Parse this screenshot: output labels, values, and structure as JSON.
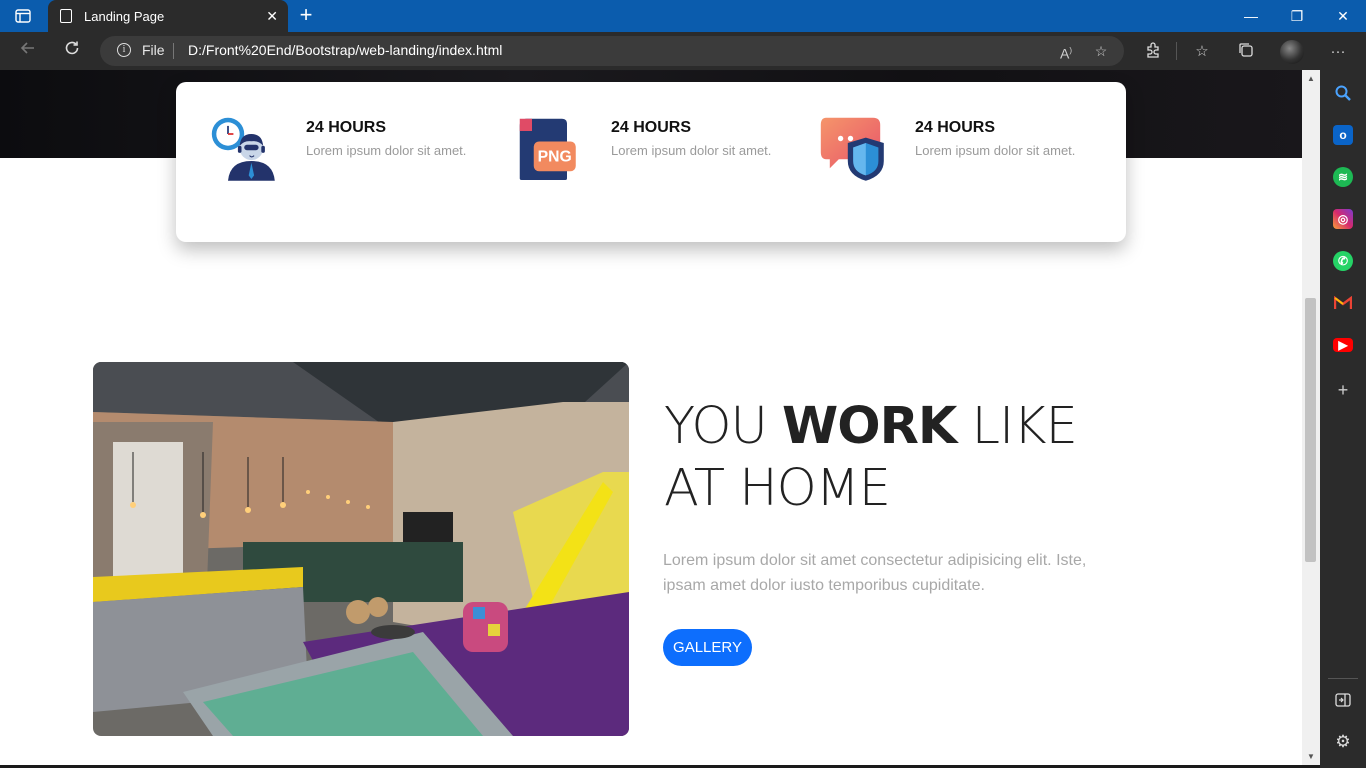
{
  "browser": {
    "tab_title": "Landing Page",
    "tab_close": "✕",
    "new_tab": "+",
    "window_controls": {
      "minimize": "—",
      "restore": "❐",
      "close": "✕"
    },
    "address": {
      "scheme_label": "File",
      "url": "D:/Front%20End/Bootstrap/web-landing/index.html"
    },
    "sidebar_icons": [
      "search-icon",
      "outlook-icon",
      "spotify-icon",
      "instagram-icon",
      "whatsapp-icon",
      "gmail-icon",
      "youtube-icon",
      "add-icon",
      "sidebar-toggle-icon",
      "settings-icon"
    ]
  },
  "features": [
    {
      "title": "24 HOURS",
      "desc": "Lorem ipsum dolor sit amet.",
      "icon": "support-agent-icon"
    },
    {
      "title": "24 HOURS",
      "desc": "Lorem ipsum dolor sit amet.",
      "icon": "png-file-icon",
      "icon_text": "PNG"
    },
    {
      "title": "24 HOURS",
      "desc": "Lorem ipsum dolor sit amet.",
      "icon": "secure-chat-icon"
    }
  ],
  "about": {
    "headline_part1": "YOU ",
    "headline_bold": "WORK",
    "headline_part2": " LIKE AT HOME",
    "paragraph": "Lorem ipsum dolor sit amet consectetur adipisicing elit. Iste, ipsam amet dolor iusto temporibus cupiditate.",
    "button": "GALLERY"
  },
  "colors": {
    "accent": "#0d6efd",
    "titlebar": "#0b5cad",
    "chrome": "#2b2b2b"
  }
}
